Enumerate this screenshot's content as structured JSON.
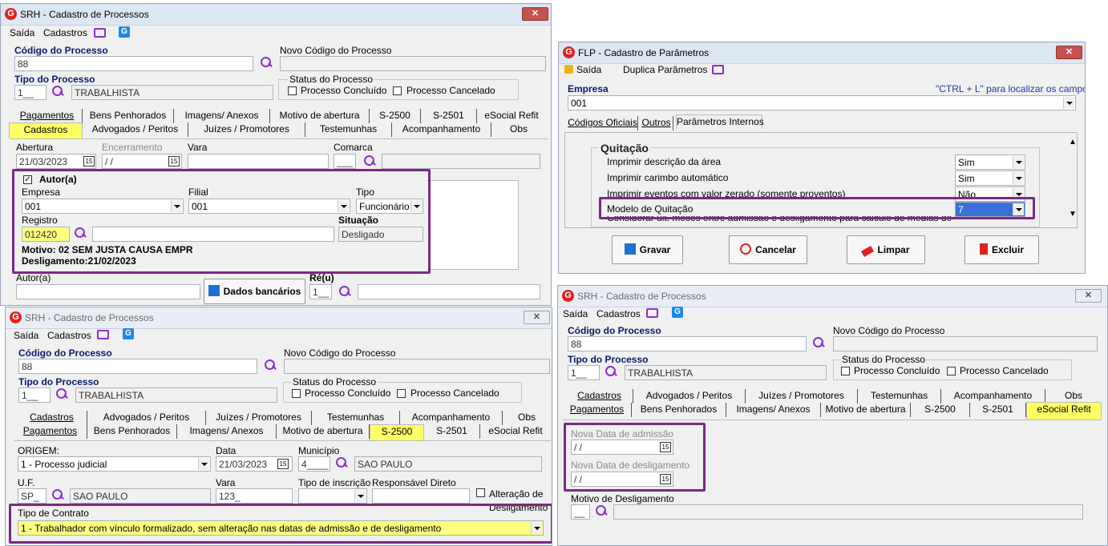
{
  "w1": {
    "title": "SRH - Cadastro de Processos",
    "menu": {
      "saida": "Saída",
      "cadastros": "Cadastros"
    },
    "codigo_label": "Código do Processo",
    "codigo_value": "88",
    "novo_codigo_label": "Novo Código do Processo",
    "tipo_label": "Tipo do Processo",
    "tipo_code": "1__",
    "tipo_value": "TRABALHISTA",
    "status_label": "Status do Processo",
    "status_concluido": "Processo Concluído",
    "status_cancelado": "Processo Cancelado",
    "tabs_row1": [
      "Pagamentos",
      "Bens Penhorados",
      "Imagens/ Anexos",
      "Motivo de abertura",
      "S-2500",
      "S-2501",
      "eSocial Refit"
    ],
    "tabs_row2": [
      "Cadastros",
      "Advogados / Peritos",
      "Juízes / Promotores",
      "Testemunhas",
      "Acompanhamento",
      "Obs"
    ],
    "abertura_label": "Abertura",
    "abertura_value": "21/03/2023",
    "encerramento_label": "Encerramento",
    "encerramento_value": " / /",
    "vara_label": "Vara",
    "comarca_label": "Comarca",
    "comarca_code": "___",
    "autor_group": "Autor(a)",
    "empresa_label": "Empresa",
    "empresa_value": "001",
    "filial_label": "Filial",
    "filial_value": "001",
    "tipo2_label": "Tipo",
    "tipo2_value": "Funcionário",
    "registro_label": "Registro",
    "registro_value": "012420",
    "situacao_label": "Situação",
    "situacao_value": "Desligado",
    "motivo_text": "Motivo: 02 SEM JUSTA CAUSA EMPR",
    "desligamento_text": "Desligamento:21/02/2023",
    "autor_label": "Autor(a)",
    "dados_bancarios": "Dados bancários",
    "reu_label": "Ré(u)",
    "reu_code": "1__",
    "cal_glyph": "15"
  },
  "w2": {
    "title": "FLP - Cadastro de Parâmetros",
    "menu": {
      "saida": "Saída",
      "duplica": "Duplica Parâmetros"
    },
    "empresa_label": "Empresa",
    "hint": "\"CTRL + L\" para localizar os campos",
    "empresa_value": "001",
    "tabs": [
      "Códigos Oficiais",
      "Outros",
      "Parâmetros Internos"
    ],
    "section": "Quitação",
    "rows": [
      {
        "label": "Imprimir descrição da área",
        "value": "Sim"
      },
      {
        "label": "Imprimir carimbo automático",
        "value": "Sim"
      },
      {
        "label": "Imprimir eventos com valor zerado (somente proventos)",
        "value": "Não"
      },
      {
        "label": "Modelo de Quitação",
        "value": "7"
      }
    ],
    "cut_row": "Considerar ult. meses entre admissão e desligamento para cálculo de médias de",
    "buttons": {
      "gravar": "Gravar",
      "cancelar": "Cancelar",
      "limpar": "Limpar",
      "excluir": "Excluir"
    }
  },
  "w3": {
    "title": "SRH - Cadastro de Processos",
    "menu": {
      "saida": "Saída",
      "cadastros": "Cadastros"
    },
    "codigo_label": "Código do Processo",
    "codigo_value": "88",
    "novo_codigo_label": "Novo Código do Processo",
    "tipo_label": "Tipo do Processo",
    "tipo_code": "1__",
    "tipo_value": "TRABALHISTA",
    "status_label": "Status do Processo",
    "status_concluido": "Processo Concluído",
    "status_cancelado": "Processo Cancelado",
    "tabs_row1": [
      "Cadastros",
      "Advogados / Peritos",
      "Juízes / Promotores",
      "Testemunhas",
      "Acompanhamento",
      "Obs"
    ],
    "tabs_row2": [
      "Pagamentos",
      "Bens Penhorados",
      "Imagens/ Anexos",
      "Motivo de abertura",
      "S-2500",
      "S-2501",
      "eSocial Refit"
    ],
    "origem_label": "ORIGEM:",
    "origem_value": "1 - Processo judicial",
    "data_label": "Data",
    "data_value": "21/03/2023",
    "municipio_label": "Município",
    "municipio_code": "4____",
    "municipio_value": "SAO PAULO",
    "uf_label": "U.F.",
    "uf_value": "SP_",
    "uf_name": "SAO PAULO",
    "vara_label": "Vara",
    "vara_value": "123_",
    "tipo_inscricao_label": "Tipo de inscrição",
    "responsavel_label": "Responsável Direto",
    "alteracao_label": "Alteração de",
    "desligamento_label": "Desligamento",
    "contrato_label": "Tipo de Contrato",
    "contrato_value": "1 - Trabalhador com vínculo formalizado, sem alteração nas datas de admissão e de desligamento",
    "cal_glyph": "15"
  },
  "w4": {
    "title": "SRH - Cadastro de Processos",
    "menu": {
      "saida": "Saída",
      "cadastros": "Cadastros"
    },
    "codigo_label": "Código do Processo",
    "codigo_value": "88",
    "novo_codigo_label": "Novo Código do Processo",
    "tipo_label": "Tipo do Processo",
    "tipo_code": "1__",
    "tipo_value": "TRABALHISTA",
    "status_label": "Status do Processo",
    "status_concluido": "Processo Concluído",
    "status_cancelado": "Processo Cancelado",
    "tabs_row1": [
      "Cadastros",
      "Advogados / Peritos",
      "Juízes / Promotores",
      "Testemunhas",
      "Acompanhamento",
      "Obs"
    ],
    "tabs_row2": [
      "Pagamentos",
      "Bens Penhorados",
      "Imagens/ Anexos",
      "Motivo de abertura",
      "S-2500",
      "S-2501",
      "eSocial Refit"
    ],
    "nova_admissao_label": "Nova Data de admissão",
    "nova_admissao_value": " / /",
    "nova_desligamento_label": "Nova Data de desligamento",
    "nova_desligamento_value": " / /",
    "motivo_label": "Motivo de Desligamento",
    "motivo_code": "__",
    "cal_glyph": "15"
  },
  "colors": {
    "highlight": "#7a2a80",
    "selected_tab": "#ffff66",
    "field_yellow": "#ffff80",
    "search_icon": "#8b2fc9",
    "brand_red": "#d22222"
  }
}
